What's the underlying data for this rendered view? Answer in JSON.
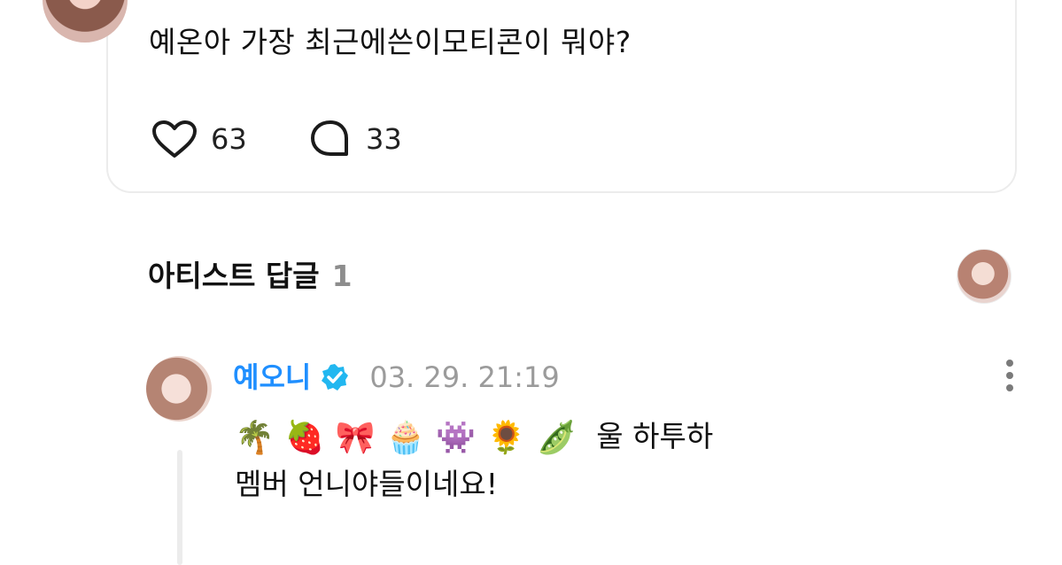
{
  "post": {
    "question": "예온아 가장 최근에쓴이모티콘이 뭐야?",
    "likes": "63",
    "comments": "33"
  },
  "artist_replies": {
    "title": "아티스트 답글",
    "count": "1"
  },
  "reply": {
    "author": "예오니",
    "timestamp": "03. 29. 21:19",
    "emojis": [
      "🌴",
      "🍓",
      "🎀",
      "🧁",
      "👾",
      "🌻",
      "🫛"
    ],
    "line1_text": "울 하투하",
    "line2_text": "멤버 언니야들이네요!"
  },
  "colors": {
    "author": "#1f8fff",
    "verified_badge": "#22b7f0",
    "muted": "#9b9b9b"
  },
  "icons": {
    "like": "heart-icon",
    "comment": "comment-bubble-icon",
    "verified": "verified-badge-icon",
    "more": "more-vertical-icon"
  }
}
